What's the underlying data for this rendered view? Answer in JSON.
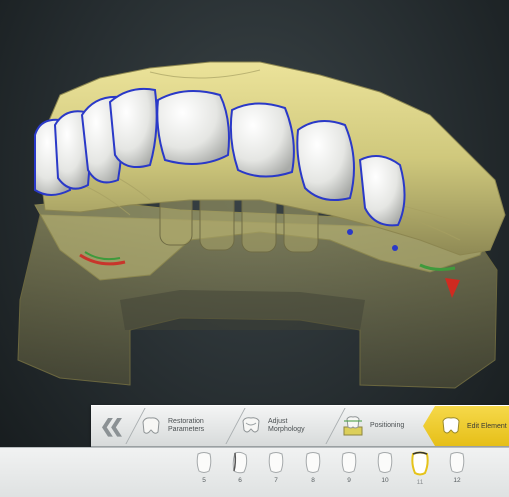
{
  "workflow": {
    "steps": [
      {
        "label": "Restoration\nParameters",
        "icon": "crown-parameters-icon"
      },
      {
        "label": "Adjust\nMorphology",
        "icon": "morphology-icon"
      },
      {
        "label": "Positioning",
        "icon": "positioning-icon"
      },
      {
        "label": "Edit Element",
        "icon": "edit-element-icon",
        "active": true
      }
    ],
    "back_icon": "double-chevron-left-icon",
    "active_color": "#f0cf2c"
  },
  "tooth_strip": {
    "teeth": [
      {
        "number": "5"
      },
      {
        "number": "6"
      },
      {
        "number": "7"
      },
      {
        "number": "8"
      },
      {
        "number": "9"
      },
      {
        "number": "10"
      },
      {
        "number": "11",
        "selected": true
      },
      {
        "number": "12"
      }
    ]
  },
  "viewport": {
    "model_color": "#d6d08a",
    "tooth_color": "#e8e9e6",
    "margin_line_color": "#2a39c8"
  }
}
